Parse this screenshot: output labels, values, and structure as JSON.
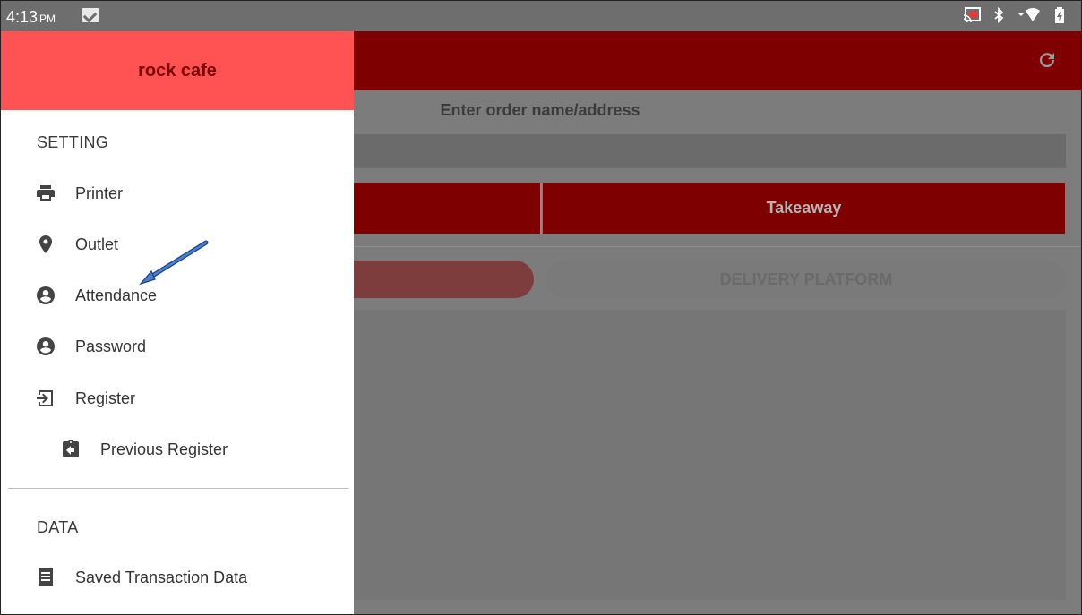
{
  "status_bar": {
    "time": "4:13",
    "ampm": "PM"
  },
  "app": {
    "order_label": "Enter order name/address",
    "order_input_value": "",
    "takeaway_label": "Takeaway",
    "platform_label": "DELIVERY PLATFORM"
  },
  "drawer": {
    "title": "rock cafe",
    "setting_header": "SETTING",
    "items": [
      {
        "label": "Printer",
        "icon": "printer-icon"
      },
      {
        "label": "Outlet",
        "icon": "location-pin-icon"
      },
      {
        "label": "Attendance",
        "icon": "account-circle-icon"
      },
      {
        "label": "Password",
        "icon": "account-circle-icon"
      },
      {
        "label": "Register",
        "icon": "login-icon"
      },
      {
        "label": "Previous Register",
        "icon": "clipboard-back-icon"
      }
    ],
    "data_header": "DATA",
    "data_items": [
      {
        "label": "Saved Transaction Data",
        "icon": "receipt-icon"
      }
    ]
  },
  "colors": {
    "header_red": "#fe5352",
    "app_bar": "#7f0000",
    "scrim_gray": "#7c7c7c",
    "annotation_arrow": "#3b6fc4"
  }
}
